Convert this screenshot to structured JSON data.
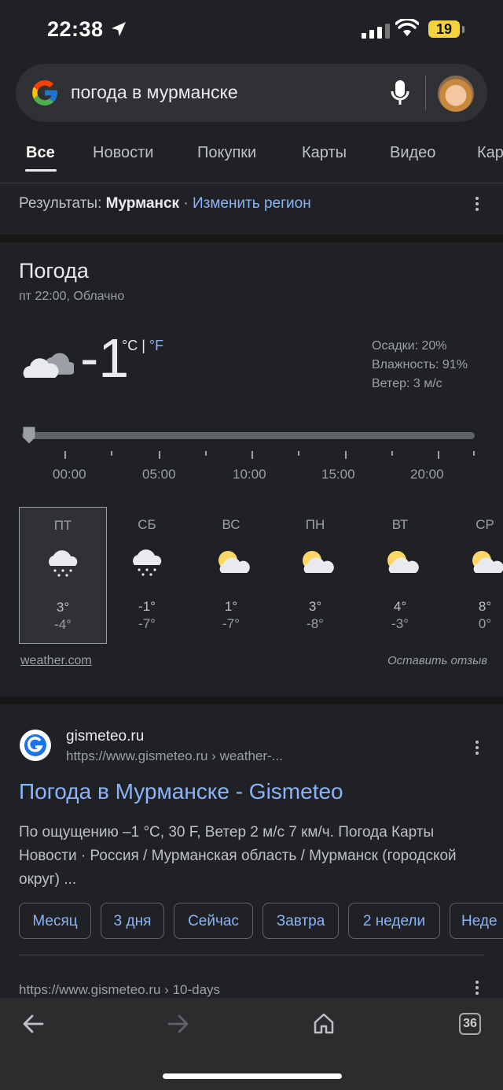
{
  "status": {
    "time": "22:38",
    "battery": "19"
  },
  "search": {
    "query": "погода в мурманске"
  },
  "tabs": [
    {
      "label": "Все"
    },
    {
      "label": "Новости"
    },
    {
      "label": "Покупки"
    },
    {
      "label": "Карты"
    },
    {
      "label": "Видео"
    },
    {
      "label": "Кар"
    }
  ],
  "region": {
    "prefix": "Результаты:",
    "city": "Мурманск",
    "dot": "·",
    "change": "Изменить регион"
  },
  "weather": {
    "title": "Погода",
    "subtitle": "пт 22:00, Облачно",
    "temp": "-1",
    "unit_c": "°C",
    "unit_sep": "|",
    "unit_f": "°F",
    "precip": "Осадки: 20%",
    "humidity": "Влажность: 91%",
    "wind": "Ветер: 3 м/с",
    "times": [
      "00:00",
      "05:00",
      "10:00",
      "15:00",
      "20:00"
    ],
    "days": [
      {
        "name": "ПТ",
        "icon": "snow-cloud-icon",
        "hi": "3°",
        "lo": "-4°"
      },
      {
        "name": "СБ",
        "icon": "snow-cloud-icon",
        "hi": "-1°",
        "lo": "-7°"
      },
      {
        "name": "ВС",
        "icon": "partly-sunny-icon",
        "hi": "1°",
        "lo": "-7°"
      },
      {
        "name": "ПН",
        "icon": "partly-sunny-icon",
        "hi": "3°",
        "lo": "-8°"
      },
      {
        "name": "ВТ",
        "icon": "partly-sunny-icon",
        "hi": "4°",
        "lo": "-3°"
      },
      {
        "name": "СР",
        "icon": "partly-sunny-icon",
        "hi": "8°",
        "lo": "0°"
      }
    ],
    "source": "weather.com",
    "feedback": "Оставить отзыв"
  },
  "result": {
    "site": "gismeteo.ru",
    "url": "https://www.gismeteo.ru › weather-...",
    "title": "Погода в Мурманске - Gismeteo",
    "snippet": "По ощущению –1 °C, 30 F, Ветер 2 м/с 7 км/ч. Погода Карты Новости · Россия / Мурманская область / Мурманск (городской округ) ...",
    "chips": [
      "Месяц",
      "3 дня",
      "Сейчас",
      "Завтра",
      "2 недели",
      "Неде"
    ],
    "url2": "https://www.gismeteo.ru › 10-days"
  },
  "toolbar": {
    "tab_count": "36"
  }
}
